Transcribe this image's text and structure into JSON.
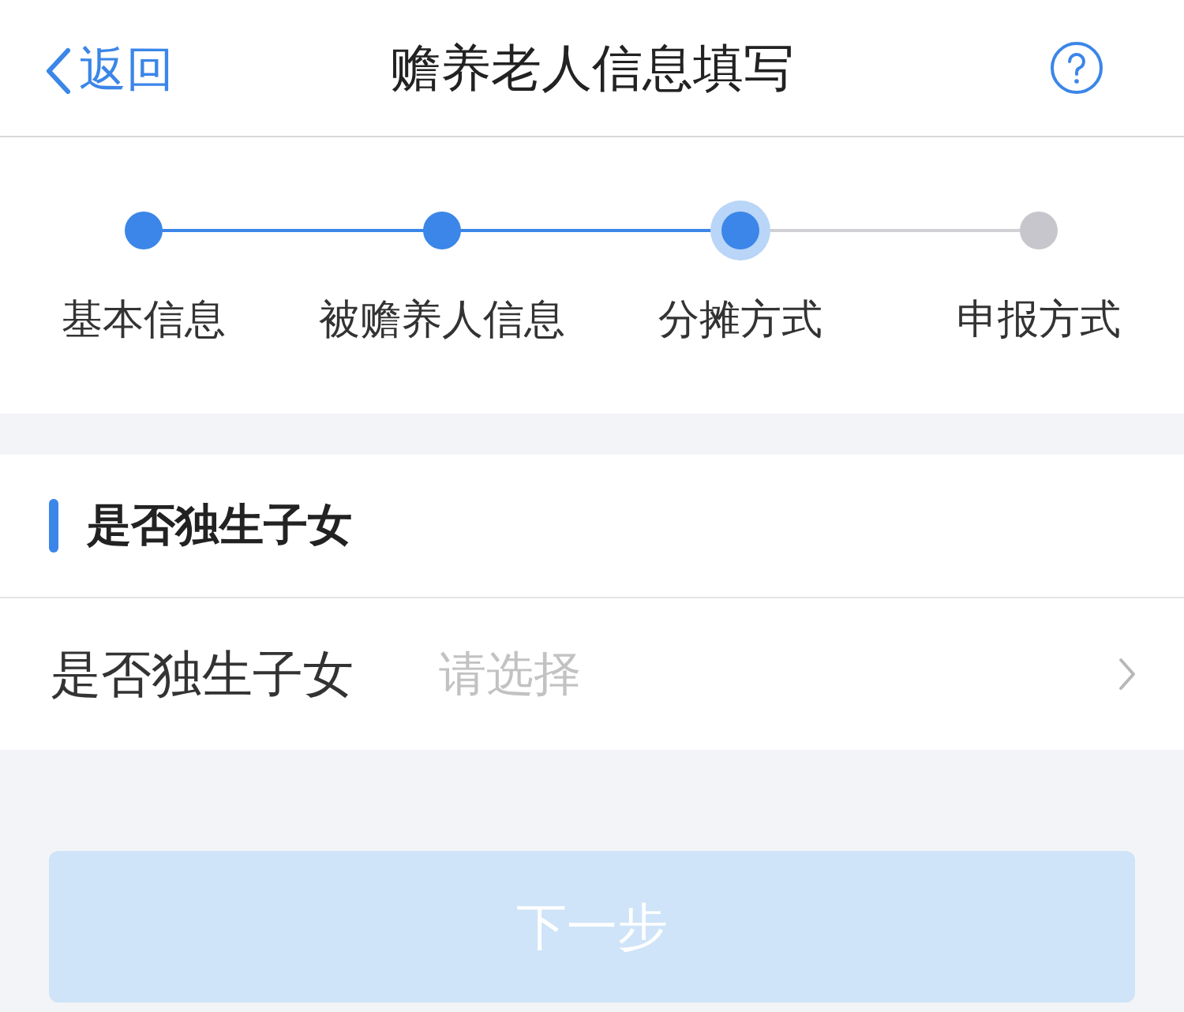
{
  "nav": {
    "back": "返回",
    "title": "赡养老人信息填写"
  },
  "steps": [
    {
      "label": "基本信息",
      "completed": true,
      "selected": false
    },
    {
      "label": "被赡养人信息",
      "completed": true,
      "selected": false
    },
    {
      "label": "分摊方式",
      "completed": true,
      "selected": true
    },
    {
      "label": "申报方式",
      "completed": false,
      "selected": false
    }
  ],
  "section": {
    "title": "是否独生子女"
  },
  "form_rows": [
    {
      "label": "是否独生子女",
      "placeholder": "请选择"
    }
  ],
  "next_button": {
    "label": "下一步",
    "disabled": true
  }
}
